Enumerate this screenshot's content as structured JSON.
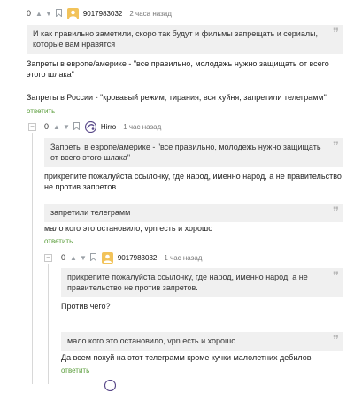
{
  "comments": [
    {
      "score": "0",
      "up_icon": "arrow-up-icon",
      "down_icon": "arrow-down-icon",
      "bookmark_icon": "bookmark-icon",
      "avatar_icon": "default-avatar-icon",
      "username": "9017983032",
      "time": "2 часа назад",
      "quote": "И как правильно заметили, скоро так будут и фильмы запрещать и сериалы, которые вам нравятся",
      "para1": "Запреты в европе/америке - \"все правильно, молодежь нужно защищать от всего этого шлака\"",
      "para2": "Запреты в России - \"кровавый режим, тирания, вся хуйня, запретили телеграмм\"",
      "reply": "ответить"
    },
    {
      "score": "0",
      "up_icon": "arrow-up-icon",
      "down_icon": "arrow-down-icon",
      "bookmark_icon": "bookmark-icon",
      "avatar_icon": "hirro-logo-icon",
      "username": "Hirro",
      "time": "1 час назад",
      "quote1": "Запреты в европе/америке - \"все правильно, молодежь нужно защищать от всего этого шлака\"",
      "text1": "прикрепите пожалуйста ссылочку, где народ, именно народ, а не правительство не против запретов.",
      "quote2": "запретили телеграмм",
      "text2": "мало кого это остановило, vpn есть и хорошо",
      "reply": "ответить"
    },
    {
      "score": "0",
      "up_icon": "arrow-up-icon",
      "down_icon": "arrow-down-icon",
      "bookmark_icon": "bookmark-icon",
      "avatar_icon": "default-avatar-icon",
      "username": "9017983032",
      "time": "1 час назад",
      "quote1": "прикрепите пожалуйста ссылочку, где народ, именно народ, а не правительство не против запретов.",
      "text1": "Против чего?",
      "quote2": "мало кого это остановило, vpn есть и хорошо",
      "text2": "Да всем похуй на этот телеграмм кроме кучки малолетних дебилов",
      "reply": "ответить"
    }
  ],
  "colors": {
    "reply_link": "#5a9d3b",
    "quote_bg": "#f0f0f0",
    "icon_gray": "#9aa0a6",
    "avatar_bg": "#f2c35a"
  }
}
